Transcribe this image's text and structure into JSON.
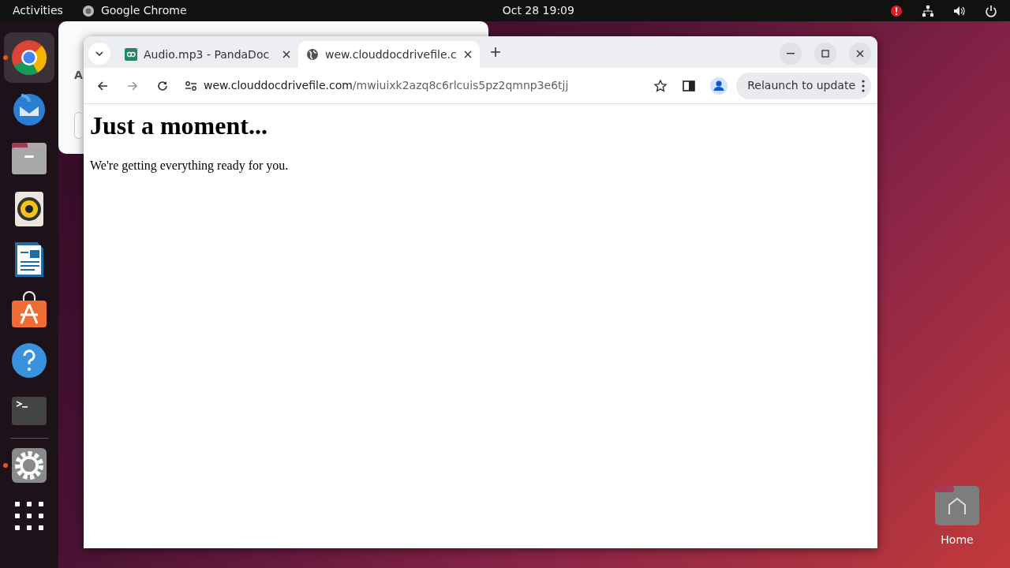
{
  "top_bar": {
    "activities": "Activities",
    "app_name": "Google Chrome",
    "clock": "Oct 28  19:09"
  },
  "dock": {
    "items": [
      {
        "kind": "chrome",
        "running": true
      },
      {
        "kind": "mail",
        "running": false
      },
      {
        "kind": "files",
        "running": false
      },
      {
        "kind": "music",
        "running": false
      },
      {
        "kind": "writer",
        "running": false
      },
      {
        "kind": "store",
        "running": false
      },
      {
        "kind": "help",
        "running": false
      },
      {
        "kind": "terminal",
        "running": false
      },
      {
        "kind": "settings",
        "running": true
      },
      {
        "kind": "apps",
        "running": false
      }
    ]
  },
  "background_window": {
    "label": "A"
  },
  "browser": {
    "tabs": [
      {
        "title": "Audio.mp3 - PandaDoc",
        "kind": "document",
        "selected": false
      },
      {
        "title": "wew.clouddocdrivefile.c",
        "kind": "web",
        "selected": true
      }
    ],
    "address": {
      "host": "wew.clouddocdrivefile.com",
      "path": "/mwiuixk2azq8c6rlcuis5pz2qmnp3e6tjj"
    },
    "relaunch_button": "Relaunch to update",
    "page": {
      "heading": "Just a moment...",
      "text": "We're getting everything ready for you."
    }
  },
  "desktop_icons": [
    {
      "label": "Home"
    }
  ]
}
